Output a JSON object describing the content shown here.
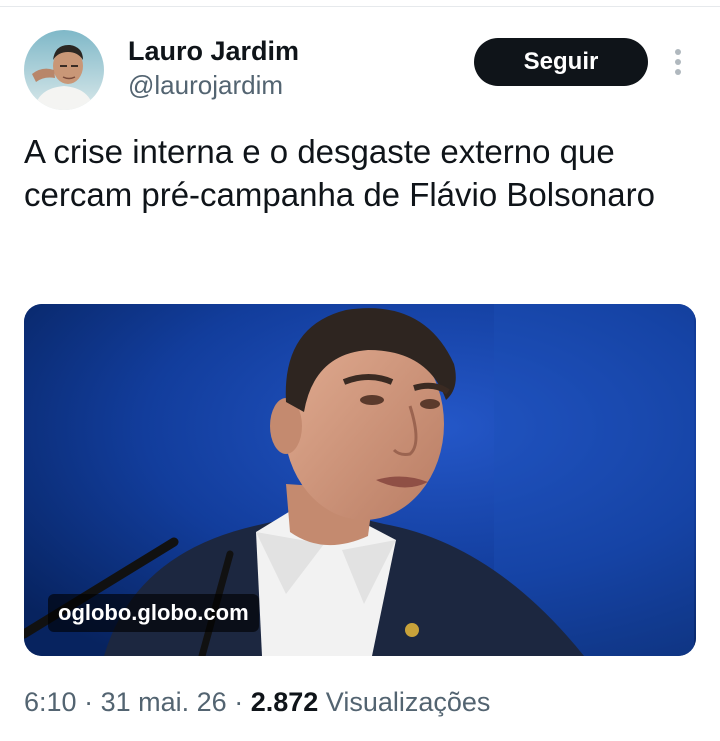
{
  "author": {
    "display_name": "Lauro Jardim",
    "handle": "@laurojardim"
  },
  "follow_button": {
    "label": "Seguir"
  },
  "more_icon": "more-vertical-icon",
  "tweet": {
    "text": "A crise interna e o desgaste externo que cercam pré-campanha de Flávio Bolsonaro"
  },
  "link_card": {
    "domain": "oglobo.globo.com"
  },
  "meta": {
    "time": "6:10",
    "separator": "·",
    "date": "31 mai. 26",
    "views_count": "2.872",
    "views_label": "Visualizações"
  },
  "colors": {
    "primary_text": "#0f1419",
    "secondary_text": "#536471",
    "follow_button_bg": "#0f1419",
    "card_background": "#0a2a6a"
  }
}
